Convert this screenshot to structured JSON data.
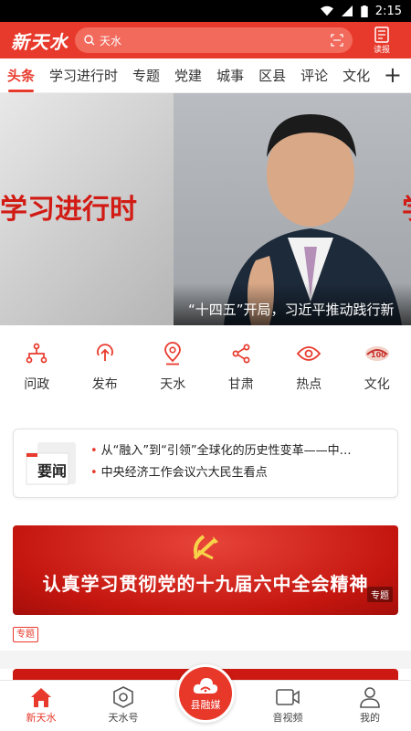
{
  "status": {
    "time": "2:15"
  },
  "header": {
    "logo": "新天水",
    "search_placeholder": "天水",
    "read_label": "读报"
  },
  "tabs": [
    {
      "label": "头条",
      "active": true
    },
    {
      "label": "学习进行时"
    },
    {
      "label": "专题"
    },
    {
      "label": "党建"
    },
    {
      "label": "城事"
    },
    {
      "label": "区县"
    },
    {
      "label": "评论"
    },
    {
      "label": "文化"
    }
  ],
  "tabs_more": "+",
  "banner": {
    "left_text": "学习进行时",
    "edge_text": "学",
    "caption": "“十四五”开局，习近平推动践行新"
  },
  "quick_links": [
    {
      "label": "问政",
      "icon": "org-chart-icon"
    },
    {
      "label": "发布",
      "icon": "upload-icon"
    },
    {
      "label": "天水",
      "icon": "location-icon"
    },
    {
      "label": "甘肃",
      "icon": "share-icon"
    },
    {
      "label": "热点",
      "icon": "eye-icon"
    },
    {
      "label": "文化",
      "icon": "culture-logo-icon"
    }
  ],
  "news": {
    "badge": "要闻",
    "items": [
      "从“融入”到“引领”全球化的历史性变革——中…",
      "中央经济工作会议六大民生看点"
    ]
  },
  "promo": {
    "title": "认真学习贯彻党的十九届六中全会精神",
    "tag": "专题"
  },
  "section_badge": "专题",
  "bottom_nav": [
    {
      "label": "新天水",
      "icon": "home-icon",
      "active": true
    },
    {
      "label": "天水号",
      "icon": "camera-badge-icon"
    },
    {
      "label": "县融媒",
      "icon": "cloud-signal-icon",
      "center": true
    },
    {
      "label": "音视频",
      "icon": "video-icon"
    },
    {
      "label": "我的",
      "icon": "user-icon"
    }
  ],
  "colors": {
    "brand": "#e83a2c"
  }
}
